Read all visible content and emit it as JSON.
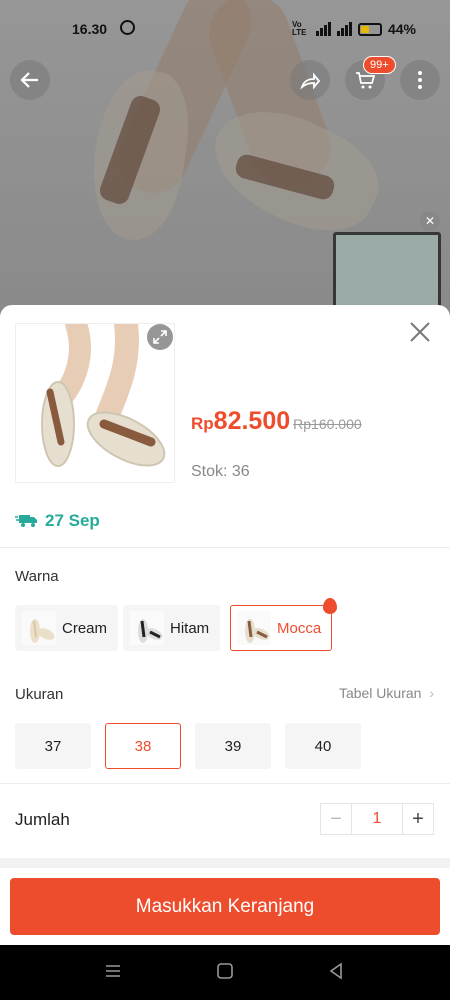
{
  "status_bar": {
    "time": "16.30",
    "network": "Vo LTE",
    "battery": "44%",
    "battery_level": 0.44
  },
  "top_actions": {
    "back_icon": "arrow-left-icon",
    "share_icon": "share-icon",
    "cart_icon": "cart-icon",
    "cart_badge": "99+",
    "more_icon": "more-vertical-icon"
  },
  "product": {
    "currency": "Rp",
    "price": "82.500",
    "old_price": "Rp160.000",
    "stock": "Stok: 36"
  },
  "delivery": {
    "date": "27 Sep",
    "icon": "truck-icon"
  },
  "variants": {
    "label": "Warna",
    "options": [
      {
        "label": "Cream",
        "selected": false
      },
      {
        "label": "Hitam",
        "selected": false
      },
      {
        "label": "Mocca",
        "selected": true
      }
    ]
  },
  "sizes": {
    "label": "Ukuran",
    "guide_label": "Tabel Ukuran",
    "options": [
      {
        "label": "37",
        "selected": false
      },
      {
        "label": "38",
        "selected": true
      },
      {
        "label": "39",
        "selected": false
      },
      {
        "label": "40",
        "selected": false
      }
    ]
  },
  "quantity": {
    "label": "Jumlah",
    "value": "1",
    "minus": "−",
    "plus": "+"
  },
  "cta": {
    "label": "Masukkan Keranjang"
  },
  "colors": {
    "accent": "#ee4d2d",
    "delivery": "#26aa99"
  }
}
